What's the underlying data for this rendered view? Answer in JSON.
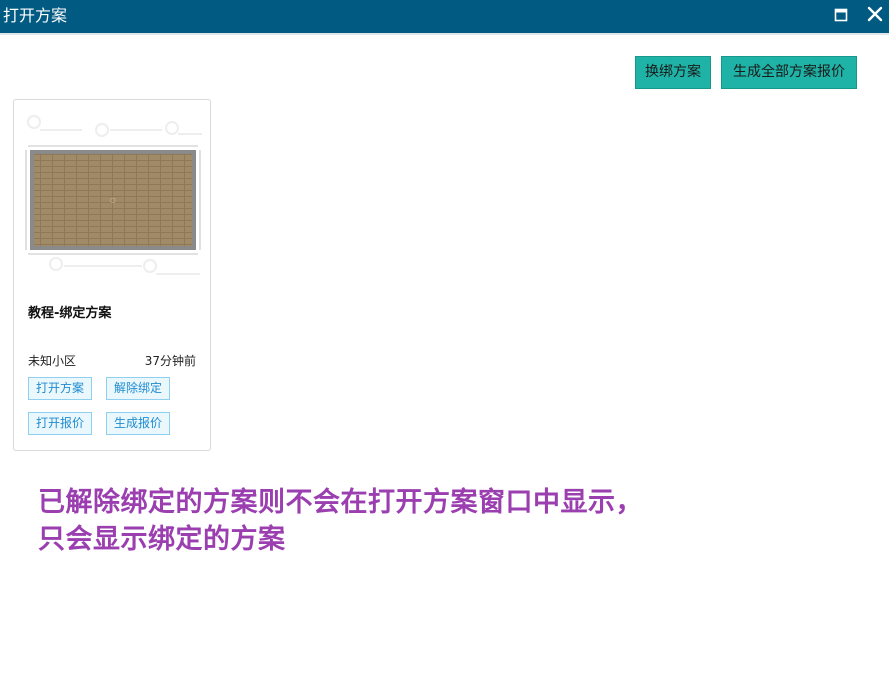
{
  "window": {
    "title": "打开方案",
    "maximize_icon": "maximize-icon",
    "close_icon": "close-icon",
    "title_bar_color": "#005a82"
  },
  "toolbar": {
    "rebind_label": "换绑方案",
    "generate_all_label": "生成全部方案报价",
    "button_color": "#1fb2a6"
  },
  "plan_card": {
    "thumbnail_label": "floor-plan-thumbnail",
    "title": "教程-绑定方案",
    "community": "未知小区",
    "time": "37分钟前",
    "buttons": {
      "open_plan": "打开方案",
      "unbind": "解除绑定",
      "open_quote": "打开报价",
      "generate_quote": "生成报价"
    }
  },
  "annotation": {
    "line1": "已解除绑定的方案则不会在打开方案窗口中显示，",
    "line2": "只会显示绑定的方案",
    "color": "#9b3fb0"
  }
}
